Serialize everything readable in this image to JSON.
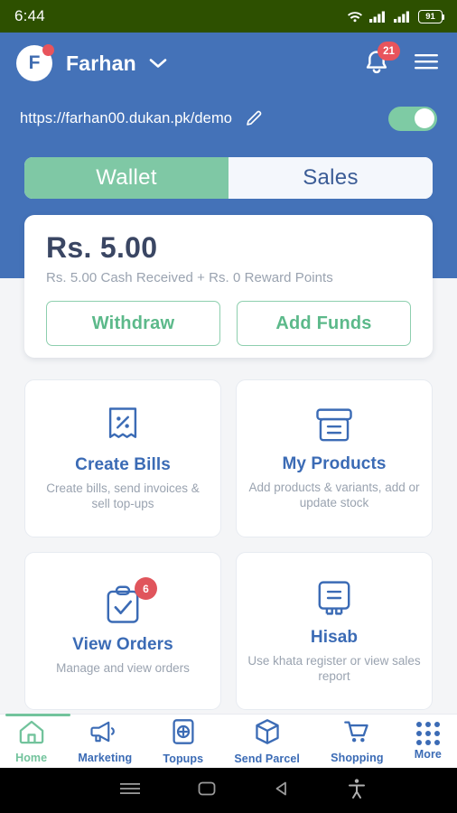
{
  "status_bar": {
    "time": "6:44",
    "wifi_icon": "wifi-icon",
    "signal_icon_1": "signal-bars-icon",
    "signal_icon_2": "signal-bars-icon",
    "battery_level": "91"
  },
  "app_bar": {
    "avatar_initial": "F",
    "shop_name": "Farhan",
    "dropdown_icon": "chevron-down-icon",
    "bell_icon": "notification-bell-icon",
    "notification_count": "21",
    "menu_icon": "hamburger-menu-icon"
  },
  "store_link": {
    "url": "https://farhan00.dukan.pk/demo",
    "edit_icon": "pencil-edit-icon",
    "toggle_state": "on"
  },
  "segment": {
    "tabs": [
      {
        "label": "Wallet",
        "active": true
      },
      {
        "label": "Sales",
        "active": false
      }
    ]
  },
  "wallet": {
    "amount": "Rs. 5.00",
    "breakdown": "Rs. 5.00 Cash Received + Rs. 0 Reward Points",
    "withdraw_label": "Withdraw",
    "add_funds_label": "Add Funds"
  },
  "tiles": [
    {
      "title": "Create Bills",
      "desc": "Create bills, send invoices & sell top-ups",
      "icon": "receipt-percent-icon",
      "badge": ""
    },
    {
      "title": "My Products",
      "desc": "Add products & variants, add or update stock",
      "icon": "archive-box-icon",
      "badge": ""
    },
    {
      "title": "View Orders",
      "desc": "Manage and view orders",
      "icon": "clipboard-check-icon",
      "badge": "6"
    },
    {
      "title": "Hisab",
      "desc": "Use khata register or view sales report",
      "icon": "ledger-book-icon",
      "badge": ""
    }
  ],
  "bottom_nav": [
    {
      "label": "Home",
      "icon": "home-icon",
      "active": true
    },
    {
      "label": "Marketing",
      "icon": "megaphone-icon",
      "active": false
    },
    {
      "label": "Topups",
      "icon": "topup-plus-icon",
      "active": false
    },
    {
      "label": "Send Parcel",
      "icon": "parcel-box-icon",
      "active": false
    },
    {
      "label": "Shopping",
      "icon": "shopping-cart-icon",
      "active": false
    },
    {
      "label": "More",
      "icon": "grid-dots-icon",
      "active": false
    }
  ],
  "system_nav": {
    "recents_icon": "recents-icon",
    "home_icon": "home-square-icon",
    "back_icon": "back-triangle-icon",
    "accessibility_icon": "accessibility-icon"
  },
  "colors": {
    "status_bar_bg": "#2d5000",
    "header_blue": "#4472b8",
    "accent_green": "#7fc8a5",
    "badge_red": "#e0555c",
    "tile_blue": "#3b6bb5",
    "page_bg": "#f4f5f7"
  }
}
